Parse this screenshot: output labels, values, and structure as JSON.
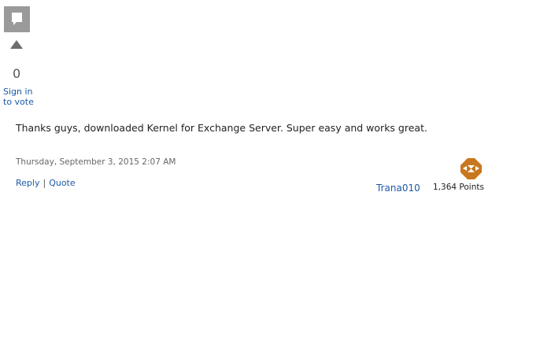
{
  "vote": {
    "count": "0",
    "sign_in_line1": "Sign in",
    "sign_in_line2": "to vote",
    "box_icon": "comment-icon",
    "arrow_icon": "up-arrow-icon"
  },
  "post": {
    "message": "Thanks guys, downloaded Kernel for Exchange Server. Super easy and works great.",
    "timestamp": "Thursday, September 3, 2015 2:07 AM"
  },
  "actions": {
    "reply_label": "Reply",
    "separator": "|",
    "quote_label": "Quote"
  },
  "author": {
    "name": "Trana010",
    "points": "1,364 Points",
    "avatar_icon": "avatar-identicon"
  },
  "colors": {
    "link": "#1b5aa6",
    "vote_box": "#9a9a9a",
    "avatar": "#c9771e"
  }
}
